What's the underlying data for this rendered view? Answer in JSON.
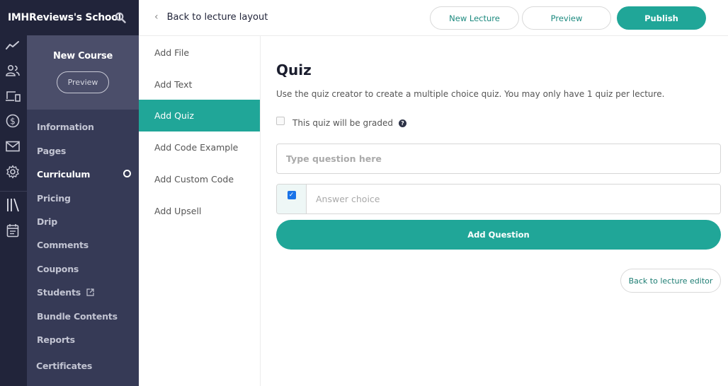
{
  "school": {
    "name": "IMHReviews's School",
    "search_icon": "search-icon"
  },
  "rail_icons": [
    {
      "name": "analytics-icon"
    },
    {
      "name": "users-icon"
    },
    {
      "name": "devices-icon"
    },
    {
      "name": "dollar-icon"
    },
    {
      "name": "mail-icon"
    },
    {
      "name": "gear-icon"
    },
    {
      "name": "library-icon"
    },
    {
      "name": "calendar-icon"
    }
  ],
  "course": {
    "title": "New Course",
    "preview_label": "Preview",
    "nav": [
      {
        "label": "Information"
      },
      {
        "label": "Pages"
      },
      {
        "label": "Curriculum",
        "active": true
      },
      {
        "label": "Pricing"
      },
      {
        "label": "Drip"
      },
      {
        "label": "Comments"
      },
      {
        "label": "Coupons"
      },
      {
        "label": "Students",
        "icon": "external-link-icon"
      },
      {
        "label": "Bundle Contents"
      },
      {
        "label": "Reports"
      },
      {
        "label": "Certificates"
      }
    ]
  },
  "topbar": {
    "back_label": "Back to lecture layout",
    "new_lecture_label": "New Lecture",
    "preview_label": "Preview",
    "publish_label": "Publish"
  },
  "add_menu": [
    {
      "label": "Add File"
    },
    {
      "label": "Add Text"
    },
    {
      "label": "Add Quiz",
      "active": true
    },
    {
      "label": "Add Code Example"
    },
    {
      "label": "Add Custom Code"
    },
    {
      "label": "Add Upsell"
    }
  ],
  "quiz": {
    "title": "Quiz",
    "description": "Use the quiz creator to create a multiple choice quiz. You may only have 1 quiz per lecture.",
    "graded_label": "This quiz will be graded",
    "graded_checked": false,
    "help_glyph": "?",
    "question_placeholder": "Type question here",
    "question_value": "",
    "answer_placeholder": "Answer choice",
    "answer_value": "",
    "answer_correct_checked": true,
    "add_question_label": "Add Question",
    "back_to_editor_label": "Back to lecture editor"
  },
  "colors": {
    "accent": "#20a698",
    "rail_bg": "#21243a",
    "sidebar_bg": "#363a56",
    "course_head_bg": "#4b4e6a"
  }
}
